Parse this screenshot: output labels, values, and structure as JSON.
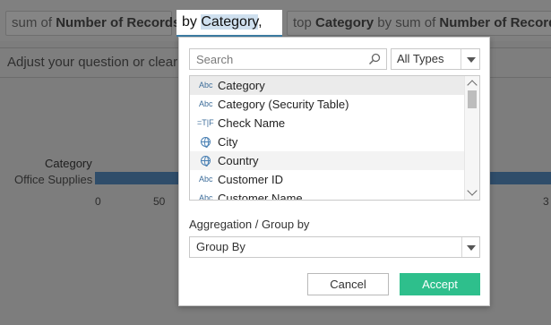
{
  "question_bar": {
    "chip_sum": {
      "prefix": "sum of ",
      "field": "Number of Records"
    },
    "active_input": {
      "prefix": "by ",
      "field": "Category",
      "suffix": ","
    },
    "chip_top": {
      "prefix": "top ",
      "field": "Category",
      "mid": " by sum of ",
      "measure": "Number of Records"
    },
    "hint": "Adjust your question or clear all"
  },
  "chart": {
    "axis_title": "Category",
    "row_label": "Office Supplies",
    "ticks": [
      "0",
      "50",
      "3"
    ]
  },
  "popup": {
    "search_placeholder": "Search",
    "type_filter": "All Types",
    "fields": [
      {
        "icon": "Abc",
        "name": "Category",
        "state": "selected"
      },
      {
        "icon": "Abc",
        "name": "Category (Security Table)",
        "state": ""
      },
      {
        "icon": "=T|F",
        "name": "Check Name",
        "state": ""
      },
      {
        "icon": "globe",
        "name": "City",
        "state": ""
      },
      {
        "icon": "globe",
        "name": "Country",
        "state": "hover"
      },
      {
        "icon": "Abc",
        "name": "Customer ID",
        "state": ""
      },
      {
        "icon": "Abc",
        "name": "Customer Name",
        "state": ""
      }
    ],
    "aggregation_label": "Aggregation / Group by",
    "aggregation_value": "Group By",
    "cancel_label": "Cancel",
    "accept_label": "Accept"
  },
  "colors": {
    "accent": "#2ebf8c",
    "bar": "#2f4d6a",
    "selection": "#cfe0ef"
  }
}
